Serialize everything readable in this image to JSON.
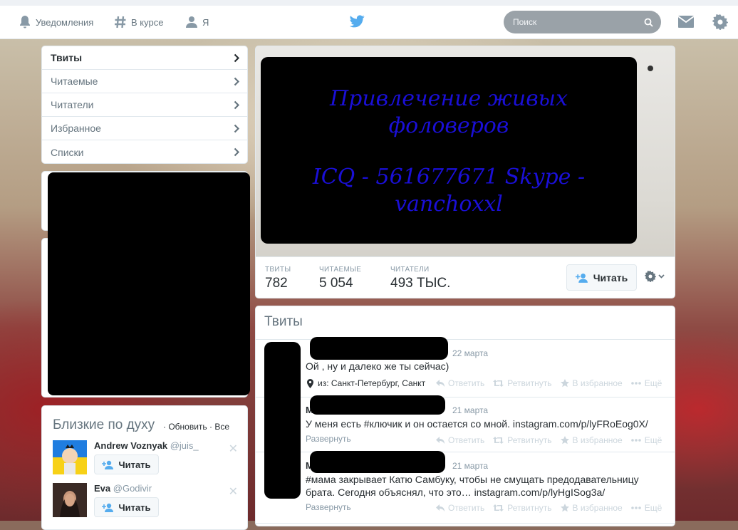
{
  "nav": {
    "notifications": "Уведомления",
    "discover": "В курсе",
    "me": "Я"
  },
  "search": {
    "placeholder": "Поиск"
  },
  "profile_menu": [
    {
      "label": "Твиты",
      "active": true
    },
    {
      "label": "Читаемые",
      "active": false
    },
    {
      "label": "Читатели",
      "active": false
    },
    {
      "label": "Избранное",
      "active": false
    },
    {
      "label": "Списки",
      "active": false
    }
  ],
  "banner": {
    "line1": "Привлечение живых",
    "line2": "фоловеров",
    "line3": "ICQ - 561677671 Skype -",
    "line4": "vanchoxxl"
  },
  "stats": {
    "tweets": {
      "label": "ТВИТЫ",
      "value": "782"
    },
    "following": {
      "label": "ЧИТАЕМЫЕ",
      "value": "5 054"
    },
    "followers": {
      "label": "ЧИТАТЕЛИ",
      "value": "493 ТЫС."
    },
    "follow_button": "Читать"
  },
  "timeline": {
    "title": "Твиты",
    "tweets": [
      {
        "date": "22 марта",
        "text": "Ой , ну и далеко же ты сейчас)",
        "location": "из: Санкт-Петербург, Санкт",
        "expand": ""
      },
      {
        "name_initial": "М",
        "date": "21 марта",
        "text_pre": "У меня есть ",
        "hashtag": "#ключик",
        "text_post": " и он остается со мной. ",
        "link": "instagram.com/p/lyFRoEog0X/",
        "expand": "Развернуть"
      },
      {
        "name_initial": "М",
        "date": "21 марта",
        "hashtag": "#мама",
        "text_post": " закрывает Катю Самбуку, чтобы не смущать предодавательницу брата. Сегодня объяснял, что это… ",
        "link": "instagram.com/p/lyHgISog3a/",
        "expand": "Развернуть"
      }
    ],
    "actions": {
      "reply": "Ответить",
      "retweet": "Ретвитнуть",
      "favorite": "В избранное",
      "more": "Ещё"
    }
  },
  "who_to_follow": {
    "title": "Близкие по духу",
    "refresh": "Обновить",
    "all": "Все",
    "separator": "·",
    "users": [
      {
        "name": "Andrew Voznyak",
        "handle": "@juis_",
        "button": "Читать"
      },
      {
        "name": "Eva",
        "handle": "@Godivir",
        "button": "Читать"
      }
    ]
  },
  "colors": {
    "twitter_blue": "#55acee",
    "action_gray": "#ccd6dd",
    "banner_text": "#1a0fd6"
  }
}
